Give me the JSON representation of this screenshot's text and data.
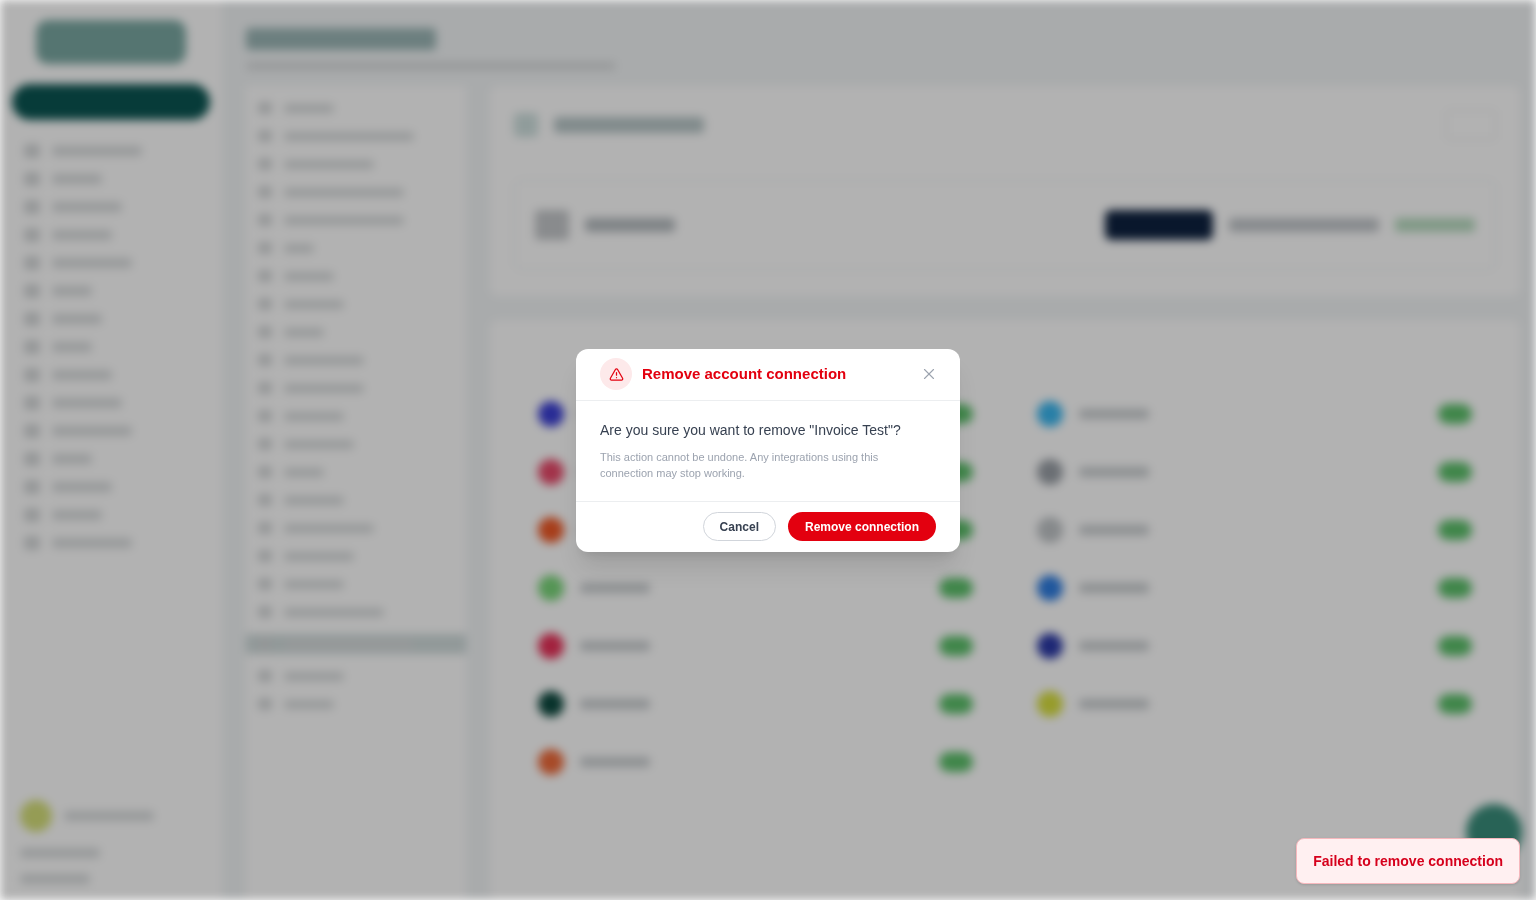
{
  "dialog": {
    "title": "Remove account connection",
    "question": "Are you sure you want to remove \"Invoice Test\"?",
    "warning": "This action cannot be undone. Any integrations using this connection may stop working.",
    "buttons": [
      {
        "label": "Cancel",
        "kind": "secondary"
      },
      {
        "label": "Remove connection",
        "kind": "danger"
      }
    ]
  },
  "toast": {
    "message": "Failed to remove connection",
    "kind": "error"
  }
}
